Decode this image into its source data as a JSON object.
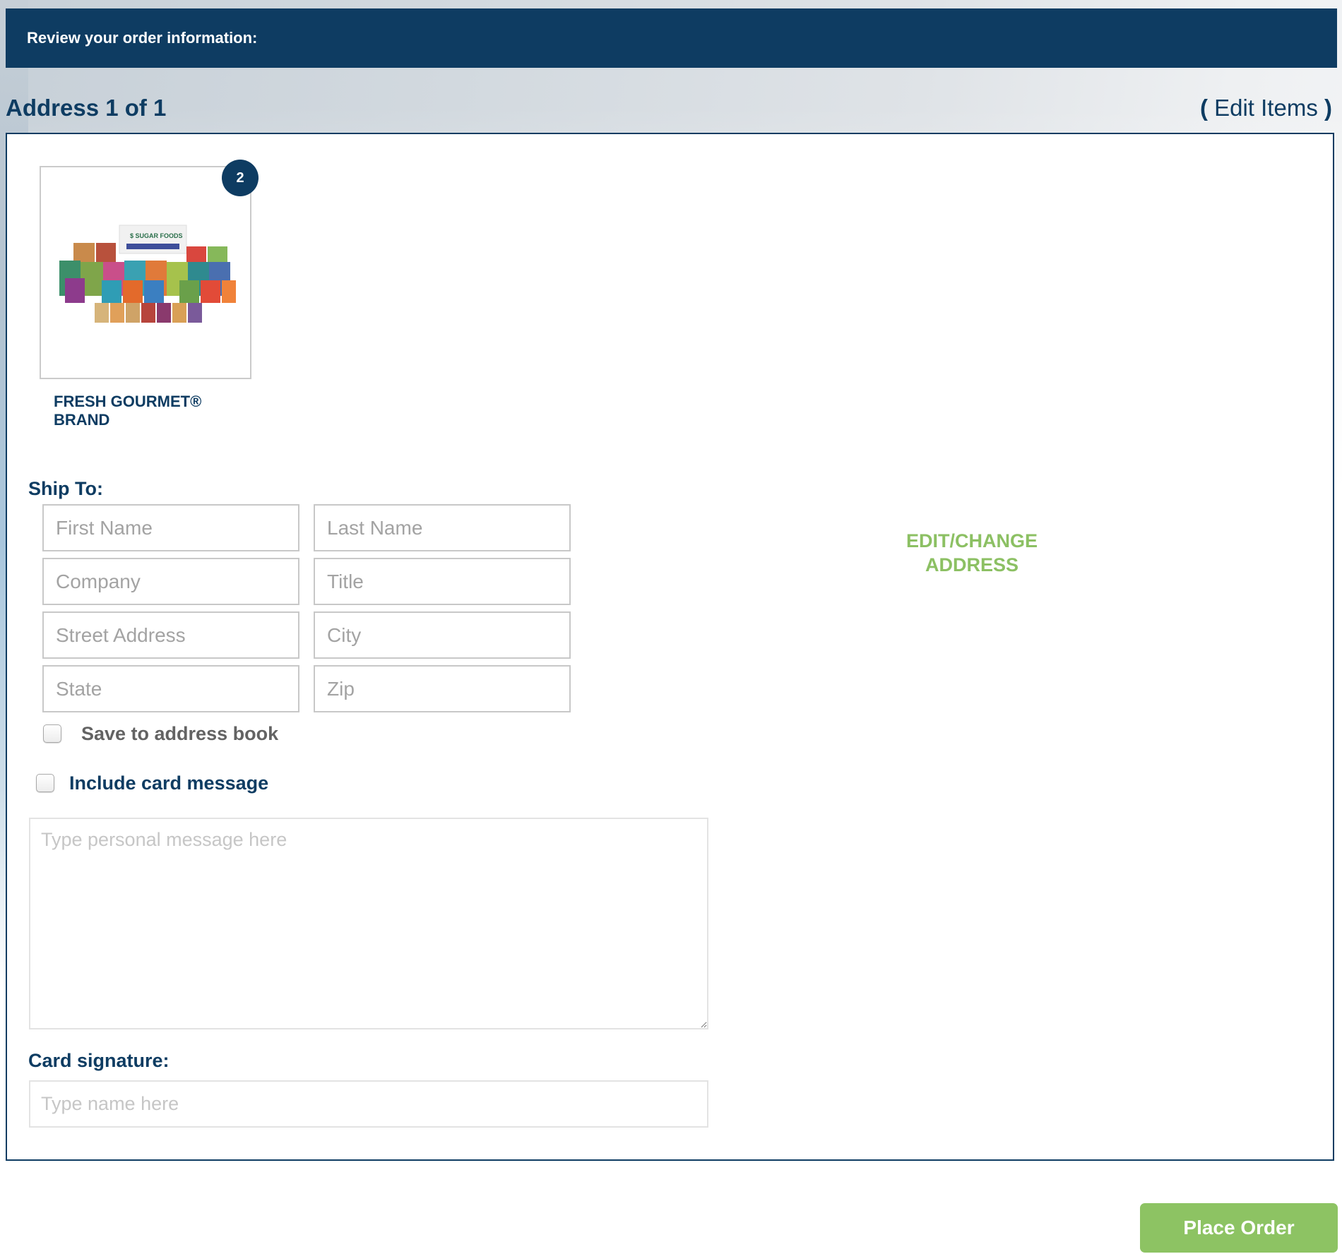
{
  "header": {
    "title": "Review your order information:"
  },
  "address_section": {
    "title": "Address 1 of 1",
    "edit_items": {
      "open_paren": "(",
      "label": "Edit Items",
      "close_paren": ")"
    }
  },
  "product": {
    "name": "FRESH GOURMET® BRAND",
    "quantity": "2",
    "image_icon": "product-assortment-image"
  },
  "ship_to": {
    "label": "Ship To:",
    "fields": {
      "first_name": {
        "placeholder": "First Name",
        "value": ""
      },
      "last_name": {
        "placeholder": "Last Name",
        "value": ""
      },
      "company": {
        "placeholder": "Company",
        "value": ""
      },
      "title": {
        "placeholder": "Title",
        "value": ""
      },
      "street_address": {
        "placeholder": "Street Address",
        "value": ""
      },
      "city": {
        "placeholder": "City",
        "value": ""
      },
      "state": {
        "placeholder": "State",
        "value": ""
      },
      "zip": {
        "placeholder": "Zip",
        "value": ""
      }
    },
    "save_to_address_book": {
      "label": "Save to address book",
      "checked": false
    },
    "edit_change_address": {
      "line1": "EDIT/CHANGE",
      "line2": "ADDRESS"
    }
  },
  "card_message": {
    "include_label": "Include card message",
    "checked": false,
    "message_placeholder": "Type personal message here",
    "signature_label": "Card signature:",
    "signature_placeholder": "Type name here"
  },
  "actions": {
    "place_order": "Place Order"
  },
  "colors": {
    "brand_navy": "#0e3c62",
    "accent_green": "#8dc363",
    "placeholder_gray": "#a3a3a3"
  }
}
